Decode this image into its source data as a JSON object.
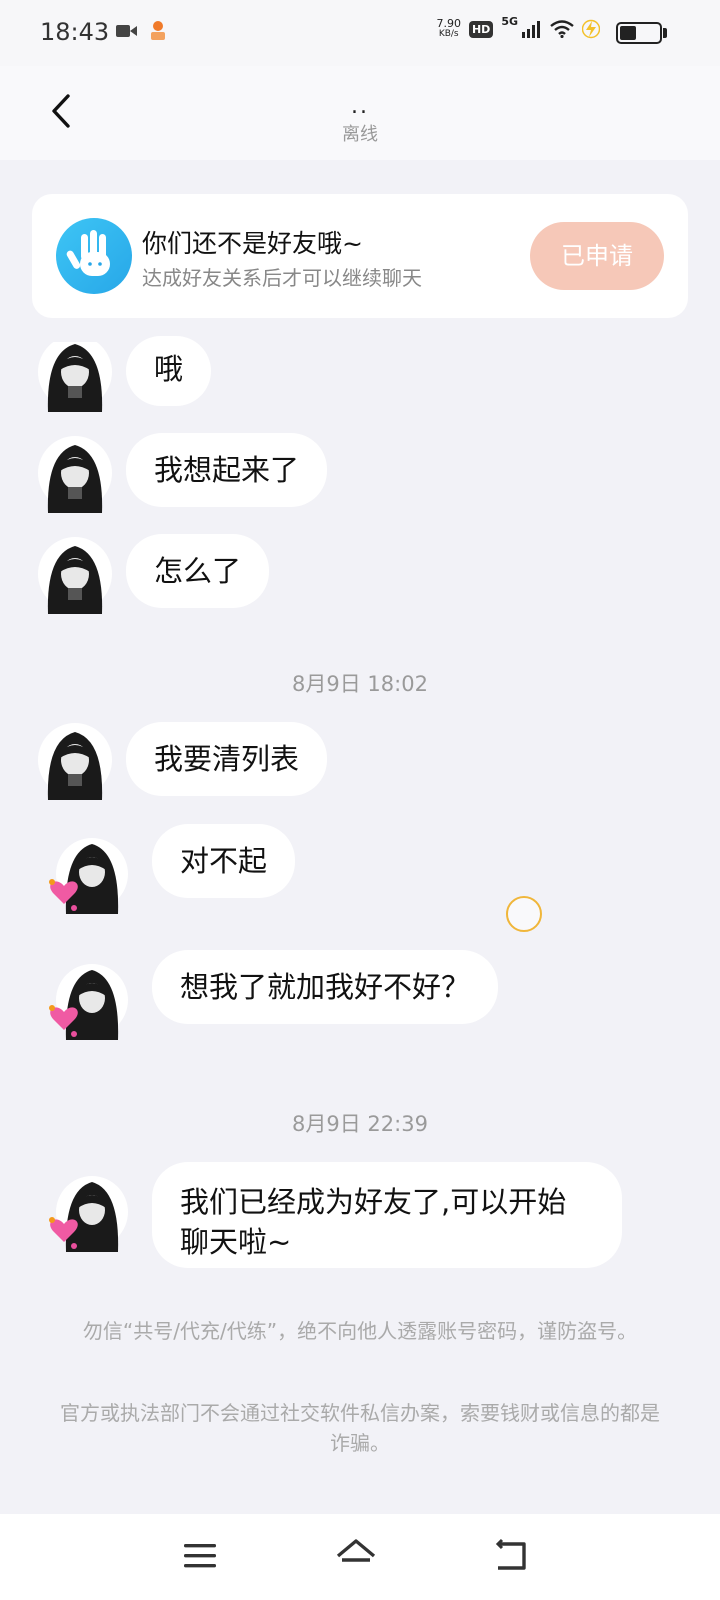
{
  "status_bar": {
    "time": "18:43",
    "net_speed_value": "7.90",
    "net_speed_unit": "KB/s",
    "hd": "HD",
    "network": "5G"
  },
  "header": {
    "name": "..",
    "status": "离线"
  },
  "banner": {
    "title": "你们还不是好友哦~",
    "subtitle": "达成好友关系后才可以继续聊天",
    "button": "已申请"
  },
  "messages": [
    {
      "sender": "them",
      "text": "哦"
    },
    {
      "sender": "them",
      "text": "我想起来了"
    },
    {
      "sender": "them",
      "text": "怎么了"
    },
    {
      "sender": "them",
      "text": "我要清列表"
    },
    {
      "sender": "other",
      "text": "对不起"
    },
    {
      "sender": "other",
      "text": "想我了就加我好不好？"
    },
    {
      "sender": "other",
      "text": "我们已经成为好友了,可以开始聊天啦~"
    }
  ],
  "timestamps": [
    "8月9日 18:02",
    "8月9日 22:39"
  ],
  "notices": [
    "勿信“共号/代充/代练”，绝不向他人透露账号密码，谨防盗号。",
    "官方或执法部门不会通过社交软件私信办案，索要钱财或信息的都是诈骗。"
  ],
  "colors": {
    "background": "#f2f2f7",
    "bubble": "#ffffff",
    "applied_button": "#f6c8b8",
    "banner_icon": "#2fb4ee"
  }
}
